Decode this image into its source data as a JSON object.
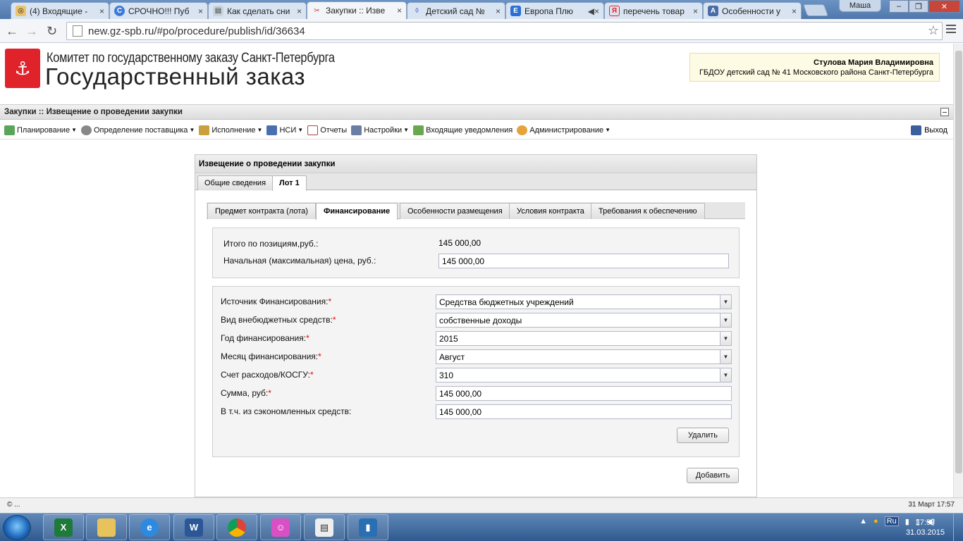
{
  "browser": {
    "tabs": [
      {
        "title": "(4) Входящие - ",
        "favicon": "mail-icon",
        "color": "#d79b1c"
      },
      {
        "title": "СРОЧНО!!! Пуб",
        "favicon": "c-icon",
        "color": "#3c7ad6"
      },
      {
        "title": "Как сделать сни",
        "favicon": "doc-icon",
        "color": "#8ab"
      },
      {
        "title": "Закупки :: Изве",
        "favicon": "tools-icon",
        "color": "#c33"
      },
      {
        "title": "Детский сад №",
        "favicon": "globe-icon",
        "color": "#5577cc"
      },
      {
        "title": "Европа Плю",
        "favicon": "radio-icon",
        "color": "#2a6fd1"
      },
      {
        "title": "перечень товар",
        "favicon": "yandex-icon",
        "color": "#e22"
      },
      {
        "title": "Особенности у",
        "favicon": "a-icon",
        "color": "#4a6ca8"
      }
    ],
    "user": "Маша",
    "url": "new.gz-spb.ru/#po/procedure/publish/id/36634"
  },
  "header": {
    "line1": "Комитет по государственному заказу Санкт-Петербурга",
    "line2": "Государственный заказ",
    "user_name": "Стулова Мария Владимировна",
    "org": "ГБДОУ детский сад № 41 Московского района Санкт-Петербурга"
  },
  "titlebar": "Закупки :: Извещение о проведении закупки",
  "menu": {
    "items": [
      {
        "label": "Планирование",
        "dropdown": true
      },
      {
        "label": "Определение поставщика",
        "dropdown": true
      },
      {
        "label": "Исполнение",
        "dropdown": true
      },
      {
        "label": "НСИ",
        "dropdown": true
      },
      {
        "label": "Отчеты",
        "dropdown": false
      },
      {
        "label": "Настройки",
        "dropdown": true
      },
      {
        "label": "Входящие уведомления",
        "dropdown": false
      },
      {
        "label": "Администрирование",
        "dropdown": true
      }
    ],
    "exit": "Выход"
  },
  "panel": {
    "title": "Извещение о проведении закупки",
    "tabs": [
      "Общие сведения",
      "Лот 1"
    ],
    "subtabs": [
      "Предмет контракта (лота)",
      "Финансирование",
      "Особенности размещения",
      "Условия контракта",
      "Требования к обеспечению"
    ],
    "totals": {
      "positions_label": "Итого по позициям,руб.:",
      "positions_value": "145 000,00",
      "max_price_label": "Начальная (максимальная) цена, руб.:",
      "max_price_value": "145 000,00"
    },
    "financing": {
      "source_label": "Источник Финансирования:",
      "source_value": "Средства бюджетных учреждений",
      "type_label": "Вид внебюджетных средств:",
      "type_value": "собственные доходы",
      "year_label": "Год финансирования:",
      "year_value": "2015",
      "month_label": "Месяц финансирования:",
      "month_value": "Август",
      "account_label": "Счет расходов/КОСГУ:",
      "account_value": "310",
      "sum_label": "Сумма, руб:",
      "sum_value": "145 000,00",
      "saved_label": "В т.ч. из сэкономленных средств:",
      "saved_value": "145 000,00",
      "required_mark": "*",
      "delete_button": "Удалить"
    },
    "add_button": "Добавить"
  },
  "status": {
    "left": "© ...",
    "right": "31 Март 17:57"
  },
  "taskbar": {
    "lang": "Ru",
    "time": "17:57",
    "date": "31.03.2015"
  }
}
